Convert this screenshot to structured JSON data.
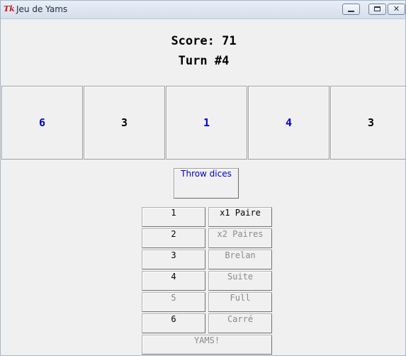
{
  "window": {
    "icon_text": "Tk",
    "title": "Jeu de Yams",
    "controls": {
      "close_glyph": "✕"
    }
  },
  "header": {
    "score_text": "Score: 71",
    "turn_text": "Turn #4"
  },
  "dice": [
    {
      "value": "6",
      "held": true
    },
    {
      "value": "3",
      "held": false
    },
    {
      "value": "1",
      "held": true
    },
    {
      "value": "4",
      "held": true
    },
    {
      "value": "3",
      "held": false
    }
  ],
  "throw_button": {
    "label": "Throw dices"
  },
  "numbers": [
    {
      "label": "1",
      "enabled": true
    },
    {
      "label": "2",
      "enabled": true
    },
    {
      "label": "3",
      "enabled": true
    },
    {
      "label": "4",
      "enabled": true
    },
    {
      "label": "5",
      "enabled": false
    },
    {
      "label": "6",
      "enabled": true
    }
  ],
  "combinations": [
    {
      "label": "x1 Paire",
      "enabled": true
    },
    {
      "label": "x2 Paires",
      "enabled": false
    },
    {
      "label": "Brelan",
      "enabled": false
    },
    {
      "label": "Suite",
      "enabled": false
    },
    {
      "label": "Full",
      "enabled": false
    },
    {
      "label": "Carré",
      "enabled": false
    }
  ],
  "yams": {
    "label": "YAMS!",
    "enabled": false
  },
  "colors": {
    "held_die": "#0000cc",
    "free_die": "#000000",
    "disabled_text": "#8a8a8a",
    "throw_text": "#0000cc"
  }
}
